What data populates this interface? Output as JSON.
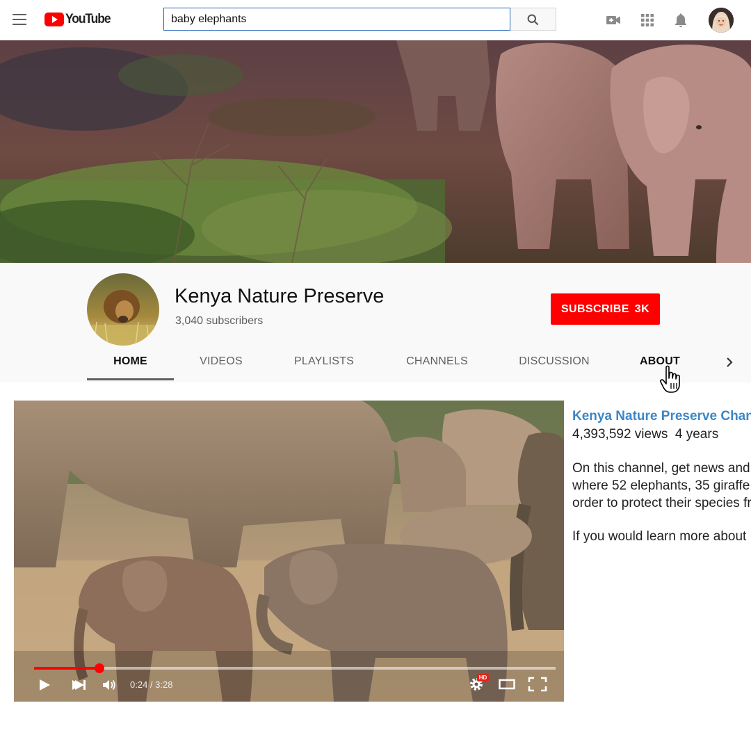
{
  "app": {
    "logo_text": "YouTube"
  },
  "search": {
    "value": "baby elephants"
  },
  "channel": {
    "name": "Kenya Nature Preserve",
    "subscribers": "3,040 subscribers",
    "subscribe_label": "SUBSCRIBE",
    "subscribe_count": "3K"
  },
  "tabs": [
    {
      "label": "HOME",
      "state": "active"
    },
    {
      "label": "VIDEOS"
    },
    {
      "label": "PLAYLISTS"
    },
    {
      "label": "CHANNELS"
    },
    {
      "label": "DISCUSSION"
    },
    {
      "label": "ABOUT",
      "state": "hover"
    }
  ],
  "player": {
    "current_time": "0:24",
    "duration": "3:28",
    "time_display": "0:24 / 3:28",
    "progress_fraction": 0.125,
    "hd_badge": "HD"
  },
  "featured": {
    "title": "Kenya Nature Preserve Channel",
    "views": "4,393,592 views",
    "age": "4 years",
    "description_lines": [
      "On this channel, get news and",
      "where 52 elephants, 35 giraffe",
      "order to protect their species fr"
    ],
    "description_more": "If you would learn more about"
  },
  "icons": {
    "menu": "hamburger-menu-icon",
    "search": "search-icon",
    "create": "video-camera-plus-icon",
    "apps": "apps-grid-icon",
    "notifications": "bell-icon",
    "tabs_next": "chevron-right-icon"
  },
  "colors": {
    "brand_red": "#ff0000",
    "link_blue": "#3d86c6",
    "search_border": "#1c62b9"
  }
}
